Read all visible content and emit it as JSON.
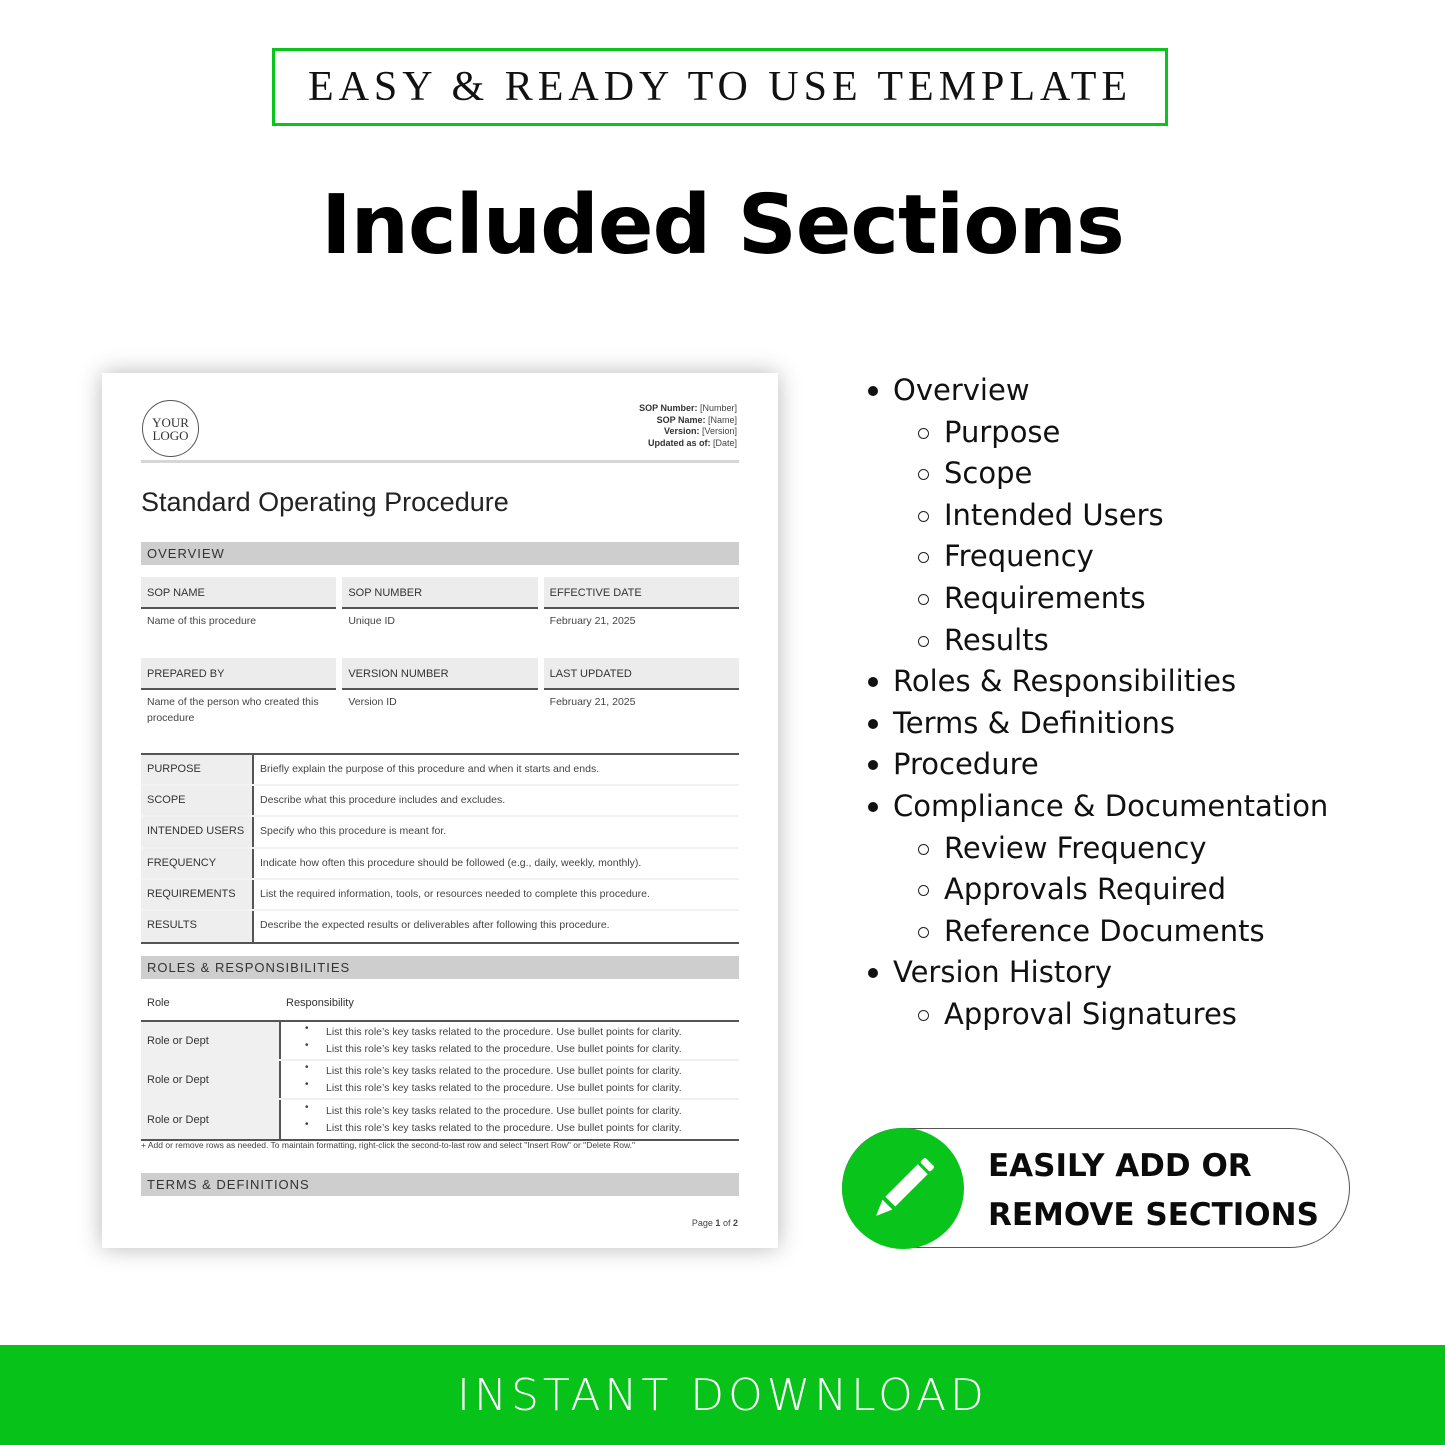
{
  "badge": {
    "text": "EASY & READY TO USE TEMPLATE",
    "border_color": "#09c41a"
  },
  "headline": "Included Sections",
  "document": {
    "logo_line1": "YOUR",
    "logo_line2": "LOGO",
    "meta": [
      {
        "label": "SOP Number:",
        "value": "[Number]"
      },
      {
        "label": "SOP Name:",
        "value": "[Name]"
      },
      {
        "label": "Version:",
        "value": "[Version]"
      },
      {
        "label": "Updated as of:",
        "value": "[Date]"
      }
    ],
    "title": "Standard Operating Procedure",
    "overview_heading": "OVERVIEW",
    "info_rows": [
      [
        {
          "head": "SOP NAME",
          "value": "Name of this procedure"
        },
        {
          "head": "SOP NUMBER",
          "value": "Unique ID"
        },
        {
          "head": "EFFECTIVE DATE",
          "value": "February 21, 2025"
        }
      ],
      [
        {
          "head": "PREPARED BY",
          "value": "Name of the person who created this procedure"
        },
        {
          "head": "VERSION NUMBER",
          "value": "Version ID"
        },
        {
          "head": "LAST UPDATED",
          "value": "February 21, 2025"
        }
      ]
    ],
    "overview_table": [
      {
        "key": "PURPOSE",
        "value": "Briefly explain the purpose of this procedure and when it starts and ends."
      },
      {
        "key": "SCOPE",
        "value": "Describe what this procedure includes and excludes."
      },
      {
        "key": "INTENDED USERS",
        "value": "Specify who this procedure is meant for."
      },
      {
        "key": "FREQUENCY",
        "value": "Indicate how often this procedure should be followed (e.g., daily, weekly, monthly)."
      },
      {
        "key": "REQUIREMENTS",
        "value": "List the required information, tools, or resources needed to complete this procedure."
      },
      {
        "key": "RESULTS",
        "value": "Describe the expected results or deliverables after following this procedure."
      }
    ],
    "roles_heading": "ROLES & RESPONSIBILITIES",
    "roles_col_role": "Role",
    "roles_col_resp": "Responsibility",
    "roles": [
      {
        "role": "Role or Dept",
        "tasks": [
          "List this role’s key tasks related to the procedure. Use bullet points for clarity.",
          "List this role’s key tasks related to the procedure. Use bullet points for clarity."
        ]
      },
      {
        "role": "Role or Dept",
        "tasks": [
          "List this role’s key tasks related to the procedure. Use bullet points for clarity.",
          "List this role’s key tasks related to the procedure. Use bullet points for clarity."
        ]
      },
      {
        "role": "Role or Dept",
        "tasks": [
          "List this role’s key tasks related to the procedure. Use bullet points for clarity.",
          "List this role’s key tasks related to the procedure. Use bullet points for clarity."
        ]
      }
    ],
    "roles_note": "+ Add or remove rows as needed. To maintain formatting, right-click the second-to-last row and select \"Insert Row\" or \"Delete Row.\"",
    "terms_heading": "TERMS & DEFINITIONS",
    "page_label": "Page",
    "page_current": "1",
    "page_of": "of",
    "page_total": "2"
  },
  "sections": [
    {
      "level": 1,
      "label": "Overview"
    },
    {
      "level": 2,
      "label": "Purpose"
    },
    {
      "level": 2,
      "label": "Scope"
    },
    {
      "level": 2,
      "label": "Intended Users"
    },
    {
      "level": 2,
      "label": "Frequency"
    },
    {
      "level": 2,
      "label": "Requirements"
    },
    {
      "level": 2,
      "label": "Results"
    },
    {
      "level": 1,
      "label": "Roles & Responsibilities"
    },
    {
      "level": 1,
      "label": "Terms & Definitions"
    },
    {
      "level": 1,
      "label": "Procedure"
    },
    {
      "level": 1,
      "label": "Compliance & Documentation"
    },
    {
      "level": 2,
      "label": "Review Frequency"
    },
    {
      "level": 2,
      "label": "Approvals Required"
    },
    {
      "level": 2,
      "label": "Reference Documents"
    },
    {
      "level": 1,
      "label": "Version History"
    },
    {
      "level": 2,
      "label": "Approval Signatures"
    }
  ],
  "pill": {
    "icon": "pencil-icon",
    "line1": "EASILY ADD OR",
    "line2": "REMOVE SECTIONS",
    "accent": "#09c41a"
  },
  "footer": {
    "text": "INSTANT DOWNLOAD",
    "bg_color": "#07c219"
  }
}
